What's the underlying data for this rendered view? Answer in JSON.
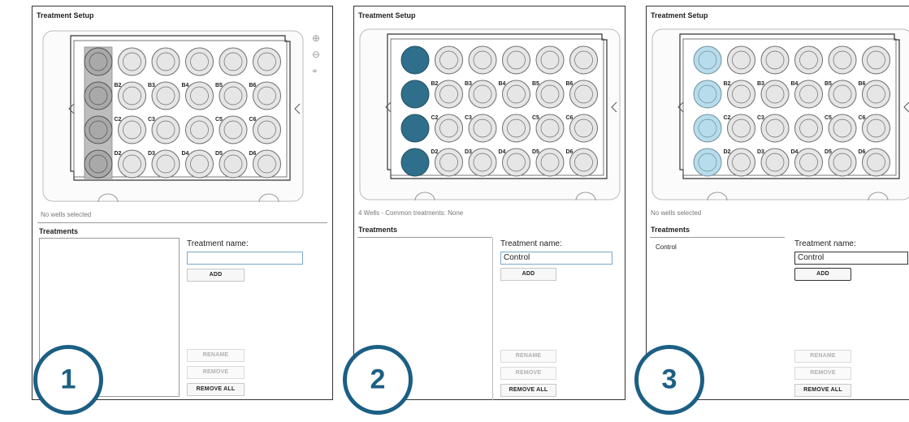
{
  "panels": [
    {
      "title": "Treatment Setup",
      "status": "No wells selected",
      "treatments_heading": "Treatments",
      "treatment_name_label": "Treatment name:",
      "treatment_name_value": "",
      "treatments": [],
      "buttons": {
        "add": "ADD",
        "rename": "RENAME",
        "remove": "REMOVE",
        "remove_all": "REMOVE ALL"
      },
      "step": "1"
    },
    {
      "title": "Treatment Setup",
      "status": "4 Wells - Common treatments: None",
      "treatments_heading": "Treatments",
      "treatment_name_label": "Treatment name:",
      "treatment_name_value": "Control",
      "treatments": [],
      "buttons": {
        "add": "ADD",
        "rename": "RENAME",
        "remove": "REMOVE",
        "remove_all": "REMOVE ALL"
      },
      "step": "2"
    },
    {
      "title": "Treatment Setup",
      "status": "No wells selected",
      "treatments_heading": "Treatments",
      "treatment_name_label": "Treatment name:",
      "treatment_name_value": "Control",
      "treatments": [
        "Control"
      ],
      "buttons": {
        "add": "ADD",
        "rename": "RENAME",
        "remove": "REMOVE",
        "remove_all": "REMOVE ALL"
      },
      "step": "3"
    }
  ],
  "plate": {
    "well_labels": [
      [
        "",
        "",
        "",
        "",
        "",
        ""
      ],
      [
        "",
        "B2",
        "B3",
        "B4",
        "B5",
        "B6"
      ],
      [
        "",
        "C2",
        "C3",
        "",
        "C5",
        "C6"
      ],
      [
        "",
        "D2",
        "D3",
        "D4",
        "D5",
        "D6"
      ]
    ],
    "column_a_state": [
      "highlighted",
      "selected",
      "assigned"
    ]
  },
  "colors": {
    "highlight_column": "#bdbdbd",
    "selected_well": "#2f6f8c",
    "assigned_well": "#b7dcec",
    "badge": "#1c5f84"
  },
  "zoom_icons": [
    "zoom-in-icon",
    "zoom-out-icon",
    "crosshair-icon"
  ]
}
